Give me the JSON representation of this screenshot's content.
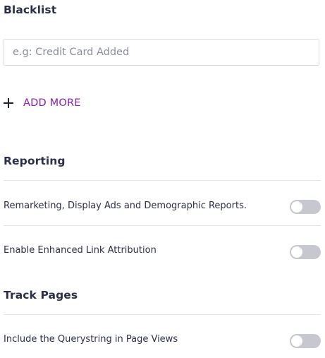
{
  "blacklist": {
    "title": "Blacklist",
    "input_placeholder": "e.g: Credit Card Added",
    "input_value": "",
    "add_more_label": "ADD MORE"
  },
  "reporting": {
    "title": "Reporting",
    "items": [
      {
        "label": "Remarketing, Display Ads and Demographic Reports.",
        "enabled": false
      },
      {
        "label": "Enable Enhanced Link Attribution",
        "enabled": false
      }
    ]
  },
  "track_pages": {
    "title": "Track Pages",
    "items": [
      {
        "label": "Include the Querystring in Page Views",
        "enabled": false
      }
    ]
  },
  "colors": {
    "heading": "#2c2f48",
    "accent": "#8a1fb0",
    "toggle_off": "#c6c7cf",
    "divider": "#e3e4ea"
  },
  "icons": {
    "add": "plus-icon"
  }
}
